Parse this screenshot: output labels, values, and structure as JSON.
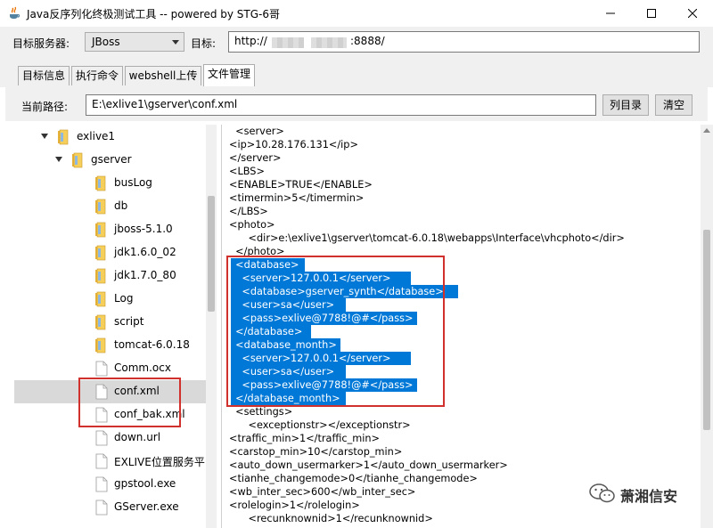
{
  "window": {
    "title": "Java反序列化终极测试工具  -- powered by STG-6哥"
  },
  "toolbar": {
    "server_label": "目标服务器:",
    "server_value": "JBoss",
    "target_label": "目标:",
    "target_prefix": "http://",
    "target_suffix": ":8888/"
  },
  "tabs": [
    {
      "label": "目标信息"
    },
    {
      "label": "执行命令"
    },
    {
      "label": "webshell上传"
    },
    {
      "label": "文件管理"
    }
  ],
  "path": {
    "label": "当前路径:",
    "value": "E:\\exlive1\\gserver\\conf.xml",
    "list_button": "列目录",
    "clear_button": "清空"
  },
  "tree": [
    {
      "label": "exlive1",
      "type": "folder",
      "expanded": true
    },
    {
      "label": "gserver",
      "type": "folder",
      "expanded": true
    },
    {
      "label": "busLog",
      "type": "folder"
    },
    {
      "label": "db",
      "type": "folder"
    },
    {
      "label": "jboss-5.1.0",
      "type": "folder"
    },
    {
      "label": "jdk1.6.0_02",
      "type": "folder"
    },
    {
      "label": "jdk1.7.0_80",
      "type": "folder"
    },
    {
      "label": "Log",
      "type": "folder"
    },
    {
      "label": "script",
      "type": "folder"
    },
    {
      "label": "tomcat-6.0.18",
      "type": "folder"
    },
    {
      "label": "Comm.ocx",
      "type": "file"
    },
    {
      "label": "conf.xml",
      "type": "file",
      "selected": true
    },
    {
      "label": "conf_bak.xml",
      "type": "file"
    },
    {
      "label": "down.url",
      "type": "file"
    },
    {
      "label": "EXLIVE位置服务平台用",
      "type": "file"
    },
    {
      "label": "gpstool.exe",
      "type": "file"
    },
    {
      "label": "GServer.exe",
      "type": "file"
    }
  ],
  "code_lines": [
    {
      "text": "  <server>",
      "sel": false
    },
    {
      "text": "<ip>10.28.176.131</ip>",
      "sel": false
    },
    {
      "text": "</server>",
      "sel": false
    },
    {
      "text": "<LBS>",
      "sel": false
    },
    {
      "text": "<ENABLE>TRUE</ENABLE>",
      "sel": false
    },
    {
      "text": "<timermin>5</timermin>",
      "sel": false
    },
    {
      "text": "</LBS>",
      "sel": false
    },
    {
      "text": "<photo>",
      "sel": false
    },
    {
      "text": "      <dir>e:\\exlive1\\gserver\\tomcat-6.0.18\\webapps\\Interface\\vhcphoto</dir>",
      "sel": false
    },
    {
      "text": "  </photo>",
      "sel": false
    },
    {
      "text": "  <database>",
      "sel": true
    },
    {
      "text": "    <server>127.0.0.1</server>",
      "sel": true
    },
    {
      "text": "    <database>gserver_synth</database>",
      "sel": true
    },
    {
      "text": "    <user>sa</user>",
      "sel": true
    },
    {
      "text": "    <pass>exlive@7788!@#</pass>",
      "sel": true
    },
    {
      "text": "  </database>",
      "sel": true
    },
    {
      "text": "  <database_month>",
      "sel": true
    },
    {
      "text": "    <server>127.0.0.1</server>",
      "sel": true
    },
    {
      "text": "    <user>sa</user>",
      "sel": true
    },
    {
      "text": "    <pass>exlive@7788!@#</pass>",
      "sel": true
    },
    {
      "text": "  </database_month>",
      "sel": true
    },
    {
      "text": "  <settings>",
      "sel": false
    },
    {
      "text": "      <exceptionstr></exceptionstr>",
      "sel": false
    },
    {
      "text": "<traffic_min>1</traffic_min>",
      "sel": false
    },
    {
      "text": "<carstop_min>10</carstop_min>",
      "sel": false
    },
    {
      "text": "<auto_down_usermarker>1</auto_down_usermarker>",
      "sel": false
    },
    {
      "text": "<tianhe_changemode>0</tianhe_changemode>",
      "sel": false
    },
    {
      "text": "<wb_inter_sec>600</wb_inter_sec>",
      "sel": false
    },
    {
      "text": "<rolelogin>1</rolelogin>",
      "sel": false
    },
    {
      "text": "      <recunknownid>1</recunknownid>",
      "sel": false
    }
  ],
  "watermark": {
    "text": "萧湘信安"
  },
  "colors": {
    "selection": "#0078d7",
    "highlight_box": "#d0312d",
    "folder": "#e8b33a"
  }
}
